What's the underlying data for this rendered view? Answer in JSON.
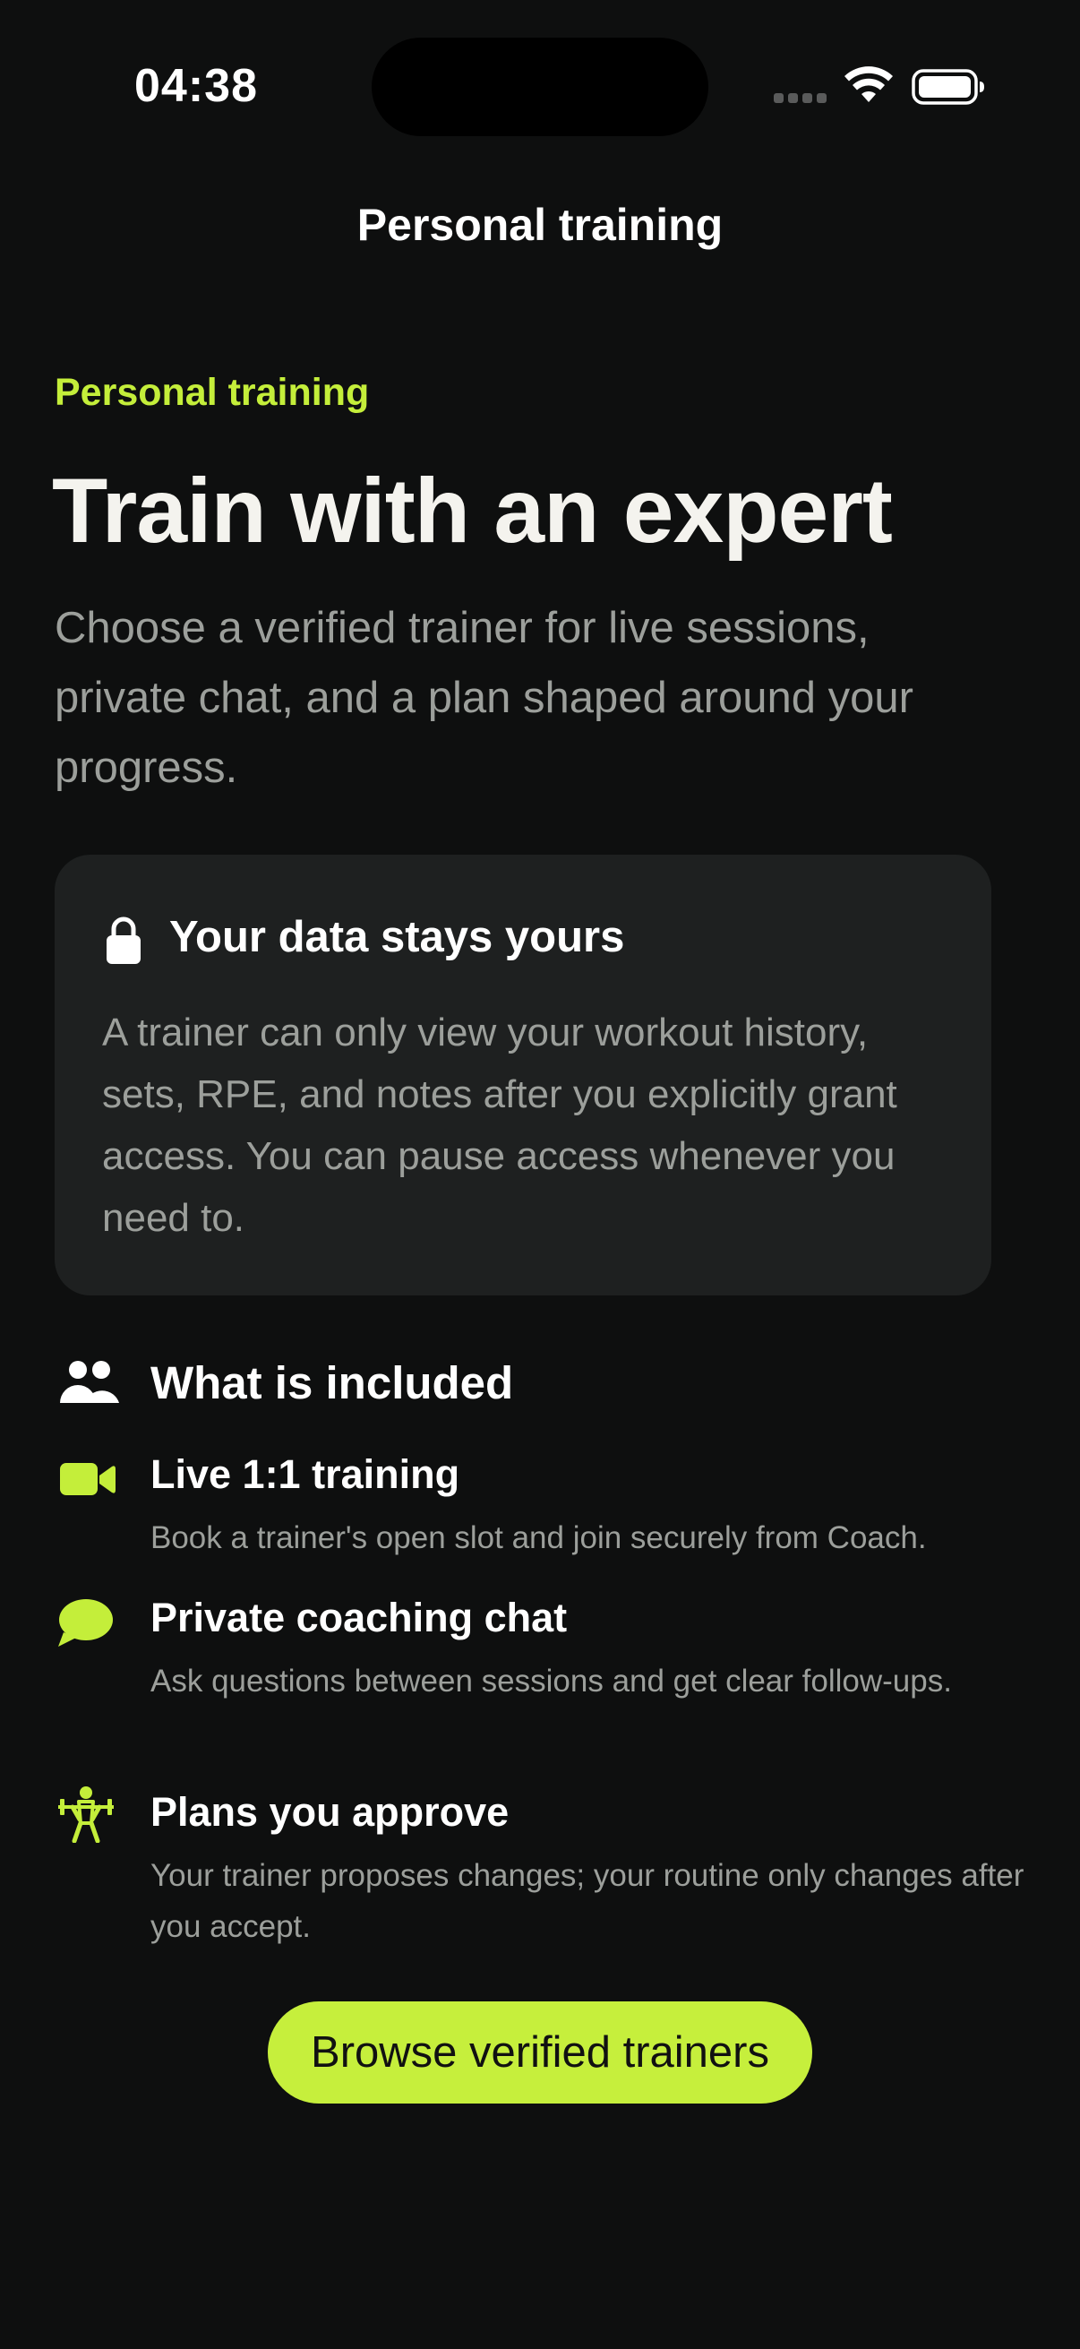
{
  "status_bar": {
    "time": "04:38"
  },
  "nav": {
    "title": "Personal training"
  },
  "hero": {
    "eyebrow": "Personal training",
    "headline": "Train with an expert",
    "intro": "Choose a verified trainer for live sessions, private chat, and a plan shaped around your progress."
  },
  "privacy_card": {
    "icon": "lock-icon",
    "title": "Your data stays yours",
    "body": "A trainer can only view your workout history, sets, RPE, and notes after you explicitly grant access. You can pause access whenever you need to."
  },
  "included": {
    "icon": "people-icon",
    "title": "What is included",
    "features": [
      {
        "icon": "video-camera-icon",
        "title": "Live 1:1 training",
        "description": "Book a trainer's open slot and join securely from Coach."
      },
      {
        "icon": "chat-bubble-icon",
        "title": "Private coaching chat",
        "description": "Ask questions between sessions and get clear follow-ups."
      },
      {
        "icon": "weightlifter-icon",
        "title": "Plans you approve",
        "description": "Your trainer proposes changes; your routine only changes after you accept."
      }
    ]
  },
  "cta": {
    "label": "Browse verified trainers"
  },
  "colors": {
    "background": "#0e0f0f",
    "accent": "#c6ef3c",
    "card": "#1e2020",
    "muted_text": "#9c9f9b"
  }
}
